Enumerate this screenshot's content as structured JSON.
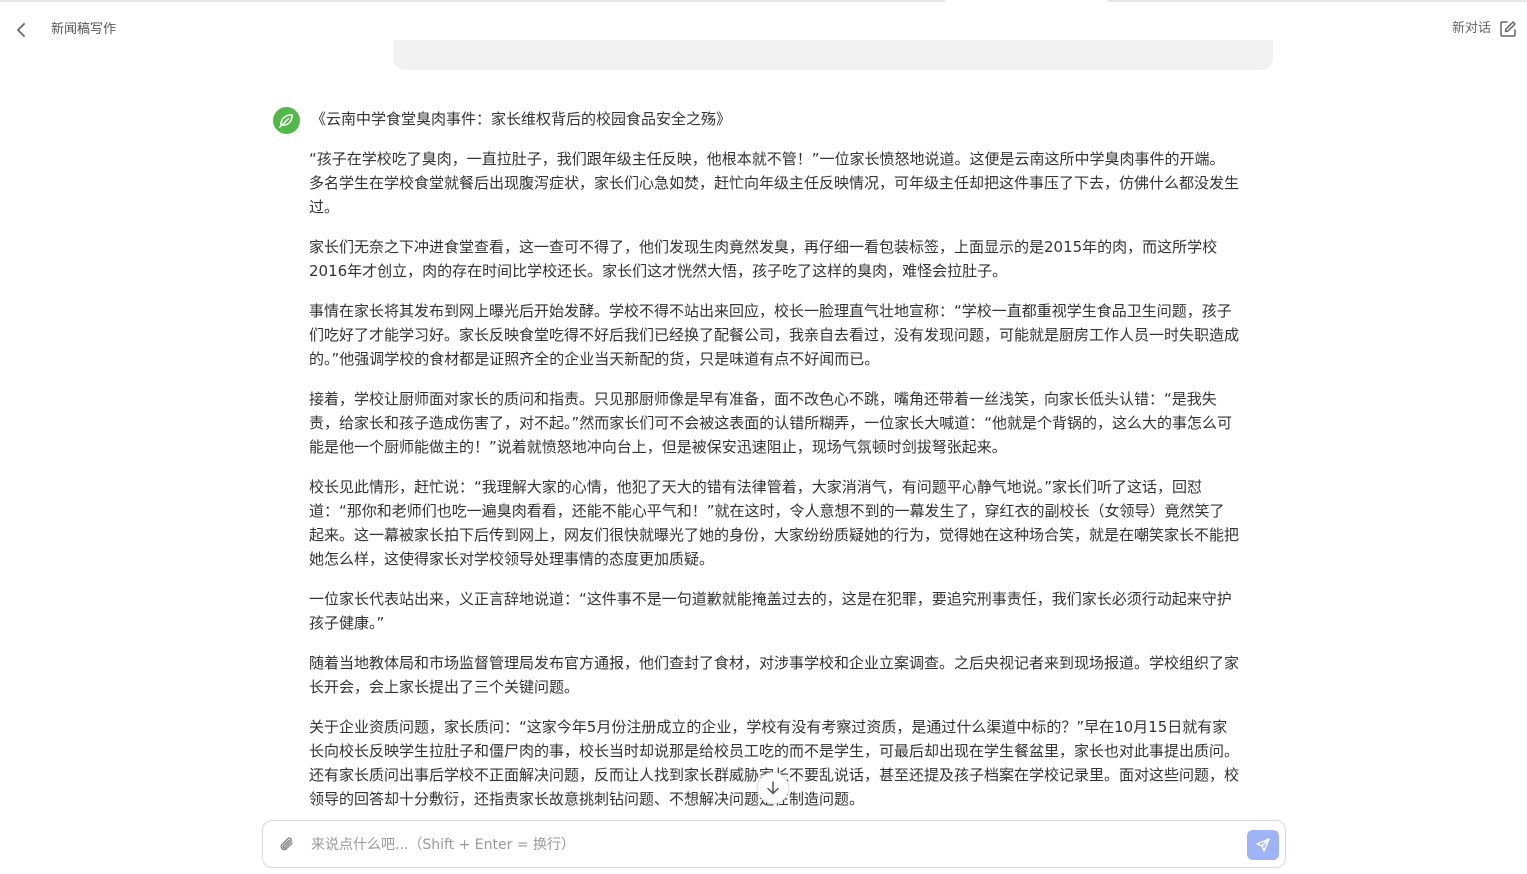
{
  "header": {
    "title": "新闻稿写作",
    "new_chat_label": "新对话"
  },
  "message": {
    "title": "《云南中学食堂臭肉事件：家长维权背后的校园食品安全之殇》",
    "paragraphs": [
      "“孩子在学校吃了臭肉，一直拉肚子，我们跟年级主任反映，他根本就不管！”一位家长愤怒地说道。这便是云南这所中学臭肉事件的开端。多名学生在学校食堂就餐后出现腹泻症状，家长们心急如焚，赶忙向年级主任反映情况，可年级主任却把这件事压了下去，仿佛什么都没发生过。",
      "家长们无奈之下冲进食堂查看，这一查可不得了，他们发现生肉竟然发臭，再仔细一看包装标签，上面显示的是2015年的肉，而这所学校2016年才创立，肉的存在时间比学校还长。家长们这才恍然大悟，孩子吃了这样的臭肉，难怪会拉肚子。",
      "事情在家长将其发布到网上曝光后开始发酵。学校不得不站出来回应，校长一脸理直气壮地宣称：“学校一直都重视学生食品卫生问题，孩子们吃好了才能学习好。家长反映食堂吃得不好后我们已经换了配餐公司，我亲自去看过，没有发现问题，可能就是厨房工作人员一时失职造成的。”他强调学校的食材都是证照齐全的企业当天新配的货，只是味道有点不好闻而已。",
      "接着，学校让厨师面对家长的质问和指责。只见那厨师像是早有准备，面不改色心不跳，嘴角还带着一丝浅笑，向家长低头认错：“是我失责，给家长和孩子造成伤害了，对不起。”然而家长们可不会被这表面的认错所糊弄，一位家长大喊道：“他就是个背锅的，这么大的事怎么可能是他一个厨师能做主的！”说着就愤怒地冲向台上，但是被保安迅速阻止，现场气氛顿时剑拔弩张起来。",
      "校长见此情形，赶忙说：“我理解大家的心情，他犯了天大的错有法律管着，大家消消气，有问题平心静气地说。”家长们听了这话，回怼道：“那你和老师们也吃一遍臭肉看看，还能不能心平气和！”就在这时，令人意想不到的一幕发生了，穿红衣的副校长（女领导）竟然笑了起来。这一幕被家长拍下后传到网上，网友们很快就曝光了她的身份，大家纷纷质疑她的行为，觉得她在这种场合笑，就是在嘲笑家长不能把她怎么样，这使得家长对学校领导处理事情的态度更加质疑。",
      "一位家长代表站出来，义正言辞地说道：“这件事不是一句道歉就能掩盖过去的，这是在犯罪，要追究刑事责任，我们家长必须行动起来守护孩子健康。”",
      "随着当地教体局和市场监督管理局发布官方通报，他们查封了食材，对涉事学校和企业立案调查。之后央视记者来到现场报道。学校组织了家长开会，会上家长提出了三个关键问题。",
      "关于企业资质问题，家长质问：“这家今年5月份注册成立的企业，学校有没有考察过资质，是通过什么渠道中标的？”早在10月15日就有家长向校长反映学生拉肚子和僵尸肉的事，校长当时却说那是给校员工吃的而不是学生，可最后却出现在学生餐盆里，家长也对此事提出质问。还有家长质问出事后学校不正面解决问题，反而让人找到家长群威胁家长不要乱说话，甚至还提及孩子档案在学校记录里。面对这些问题，校领导的回答却十分敷衍，还指责家长故意挑刺钻问题、不想解决问题是在制造问题。"
    ]
  },
  "input": {
    "placeholder": "来说点什么吧...（Shift + Enter = 换行）",
    "value": ""
  },
  "icons": {
    "back": "chevron-left-icon",
    "new_chat": "edit-icon",
    "avatar": "assistant-leaf-icon",
    "scroll": "arrow-down-icon",
    "attach": "paperclip-icon",
    "send": "send-icon"
  },
  "colors": {
    "accent_send": "#9fb4f7",
    "avatar_green": "#52b84a"
  }
}
